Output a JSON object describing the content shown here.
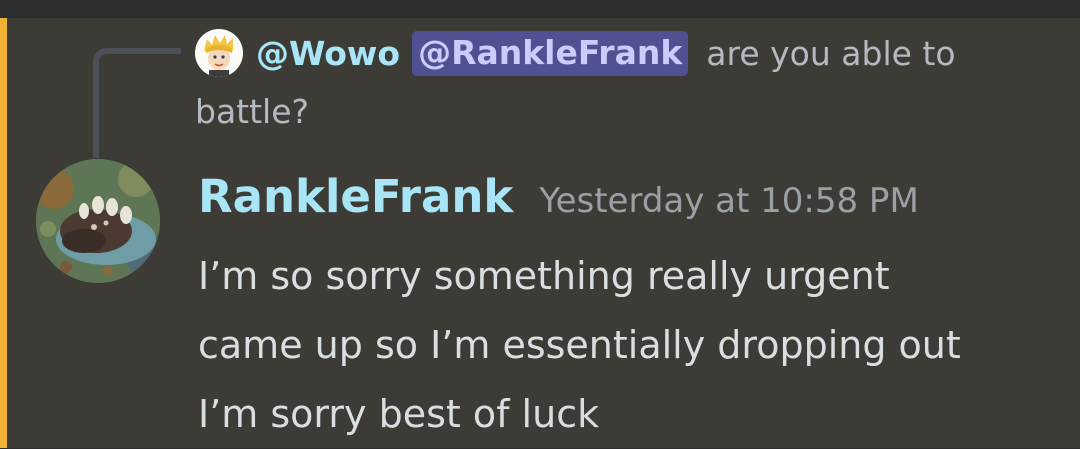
{
  "reply": {
    "author": "@Wowo",
    "mention": "@RankleFrank",
    "text_line1": "are you able to",
    "text_line2": "battle?"
  },
  "message": {
    "author": "RankleFrank",
    "timestamp": "Yesterday at 10:58 PM",
    "content_lines": [
      "I’m so sorry something really urgent",
      "came up so I’m essentially dropping out",
      "I’m sorry best of luck"
    ]
  },
  "colors": {
    "background": "#3c3b36",
    "mention_bar": "#f0b232",
    "username": "#a8e6f7",
    "mention_bg": "#4f5193",
    "text": "#dbdee1",
    "muted": "#9ba0a6"
  }
}
